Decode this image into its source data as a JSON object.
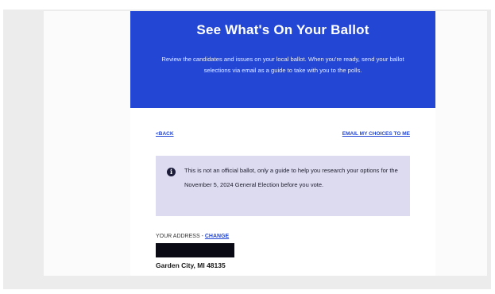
{
  "hero": {
    "title": "See What's On Your Ballot",
    "description": "Review the candidates and issues on your local ballot. When you're ready, send your ballot selections via email as a guide to take with you to the polls."
  },
  "nav": {
    "back_label": "<BACK",
    "email_label": "EMAIL MY CHOICES TO ME"
  },
  "notice": {
    "icon": "info-icon",
    "text": "This is not an official ballot, only a guide to help you research your options for the November 5, 2024 General Election before you vote."
  },
  "address": {
    "label": "YOUR ADDRESS - ",
    "change_label": "CHANGE",
    "city_line": "Garden City, MI 48135"
  },
  "colors": {
    "accent": "#2347d4",
    "notice_bg": "#dcdbf0",
    "backdrop": "#ececec"
  }
}
